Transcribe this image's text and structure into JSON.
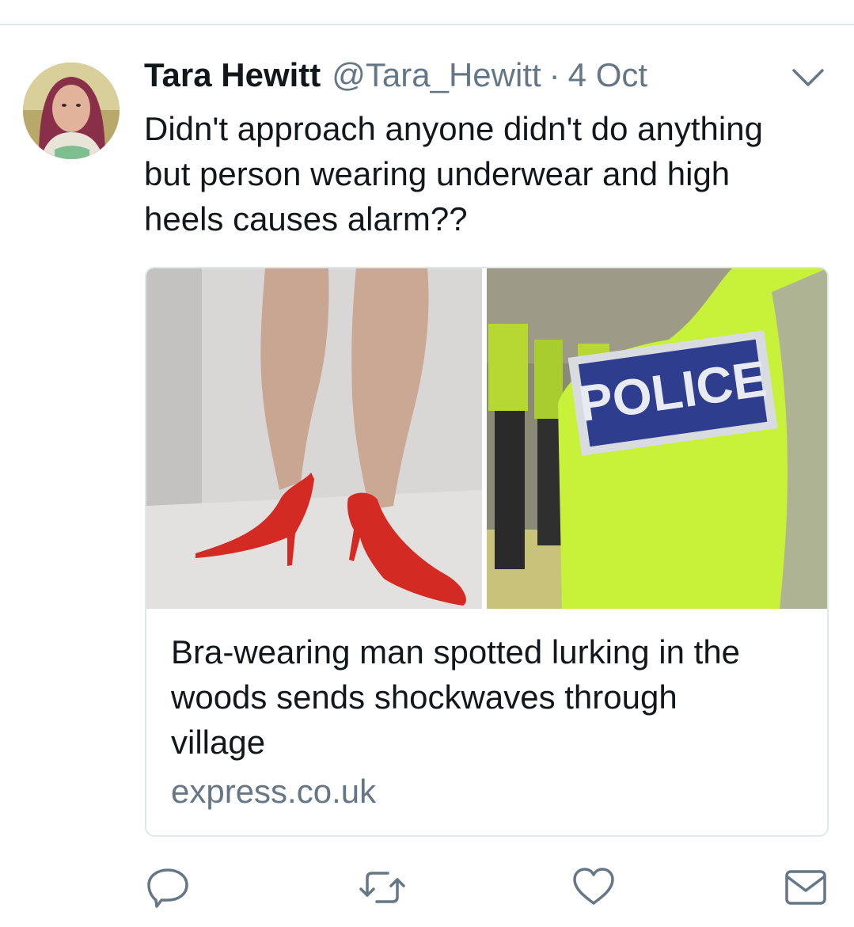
{
  "tweet": {
    "author_name": "Tara Hewitt",
    "handle": "@Tara_Hewitt",
    "separator": "·",
    "date": "4 Oct",
    "text_lines": [
      "Didn't approach anyone didn't do anything",
      "but person wearing underwear and high",
      "heels causes alarm??"
    ]
  },
  "card": {
    "title_lines": [
      "Bra-wearing man spotted lurking in the",
      "woods sends shockwaves through",
      "village"
    ],
    "domain": "express.co.uk",
    "image_overlay_text": "POLICE"
  },
  "icons": {
    "caret": "chevron-down-icon",
    "reply": "reply-icon",
    "retweet": "retweet-icon",
    "like": "heart-icon",
    "dm": "mail-icon"
  },
  "colors": {
    "text_primary": "#14171a",
    "text_secondary": "#657786",
    "border": "#e1e8ed",
    "shoe_red": "#d42a24",
    "vest_yellow": "#c8f23a",
    "police_blue": "#2e3d8e"
  }
}
